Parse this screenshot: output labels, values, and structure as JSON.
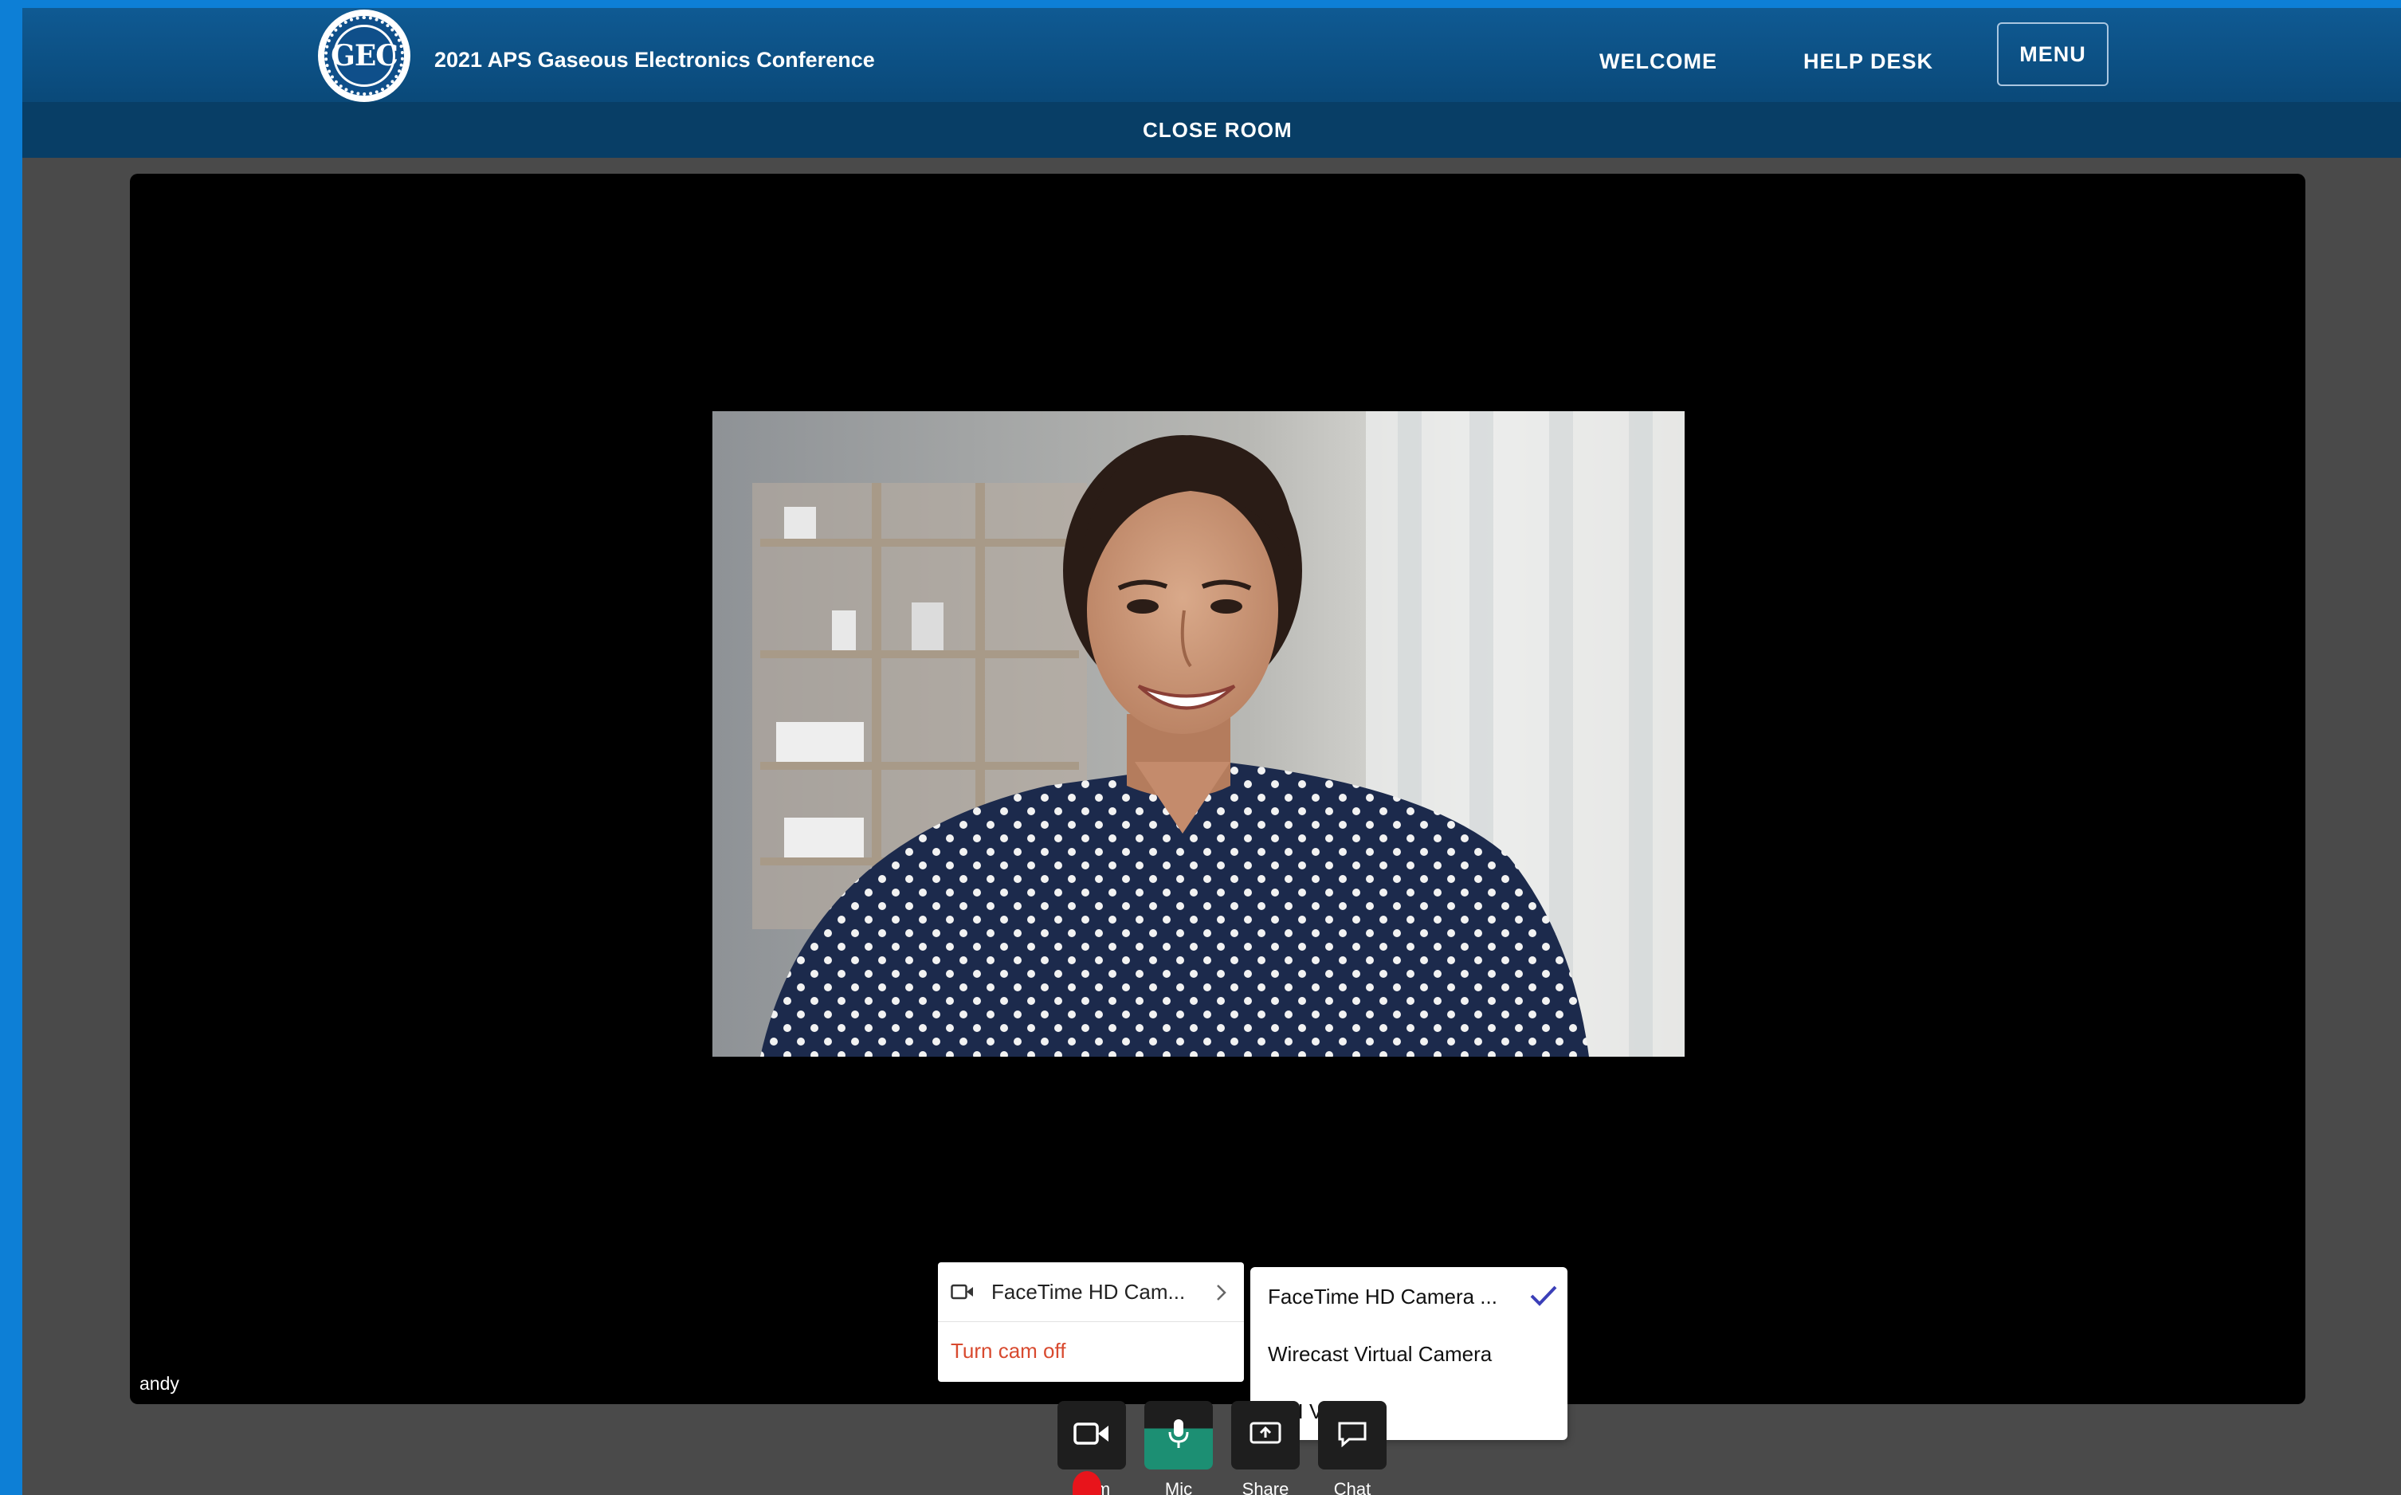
{
  "header": {
    "logo_text": "GEC",
    "site_title": "2021 APS Gaseous Electronics Conference",
    "nav": {
      "welcome": "WELCOME",
      "help_desk": "HELP DESK",
      "menu": "MENU"
    }
  },
  "room_bar": {
    "close_room": "CLOSE ROOM"
  },
  "video": {
    "participant_name": "andy"
  },
  "cam_menu": {
    "selected_device": "FaceTime HD Cam...",
    "turn_off": "Turn cam off"
  },
  "device_submenu": {
    "options": [
      "FaceTime HD Camera ...",
      "Wirecast Virtual Camera",
      "NDI Video"
    ],
    "checked_index": 0
  },
  "toolbar": {
    "cam_label": "Cam",
    "mic_label": "Mic",
    "share_label": "Share",
    "chat_label": "Chat"
  },
  "colors": {
    "outer_background": "#0d7fd6",
    "header_background": "#0a4979",
    "close_bar_background": "#083e66",
    "page_background": "#4a4a4a",
    "mic_active": "#1c8f73",
    "turn_off_text": "#d84a2f",
    "checkmark": "#3b3fb8"
  }
}
